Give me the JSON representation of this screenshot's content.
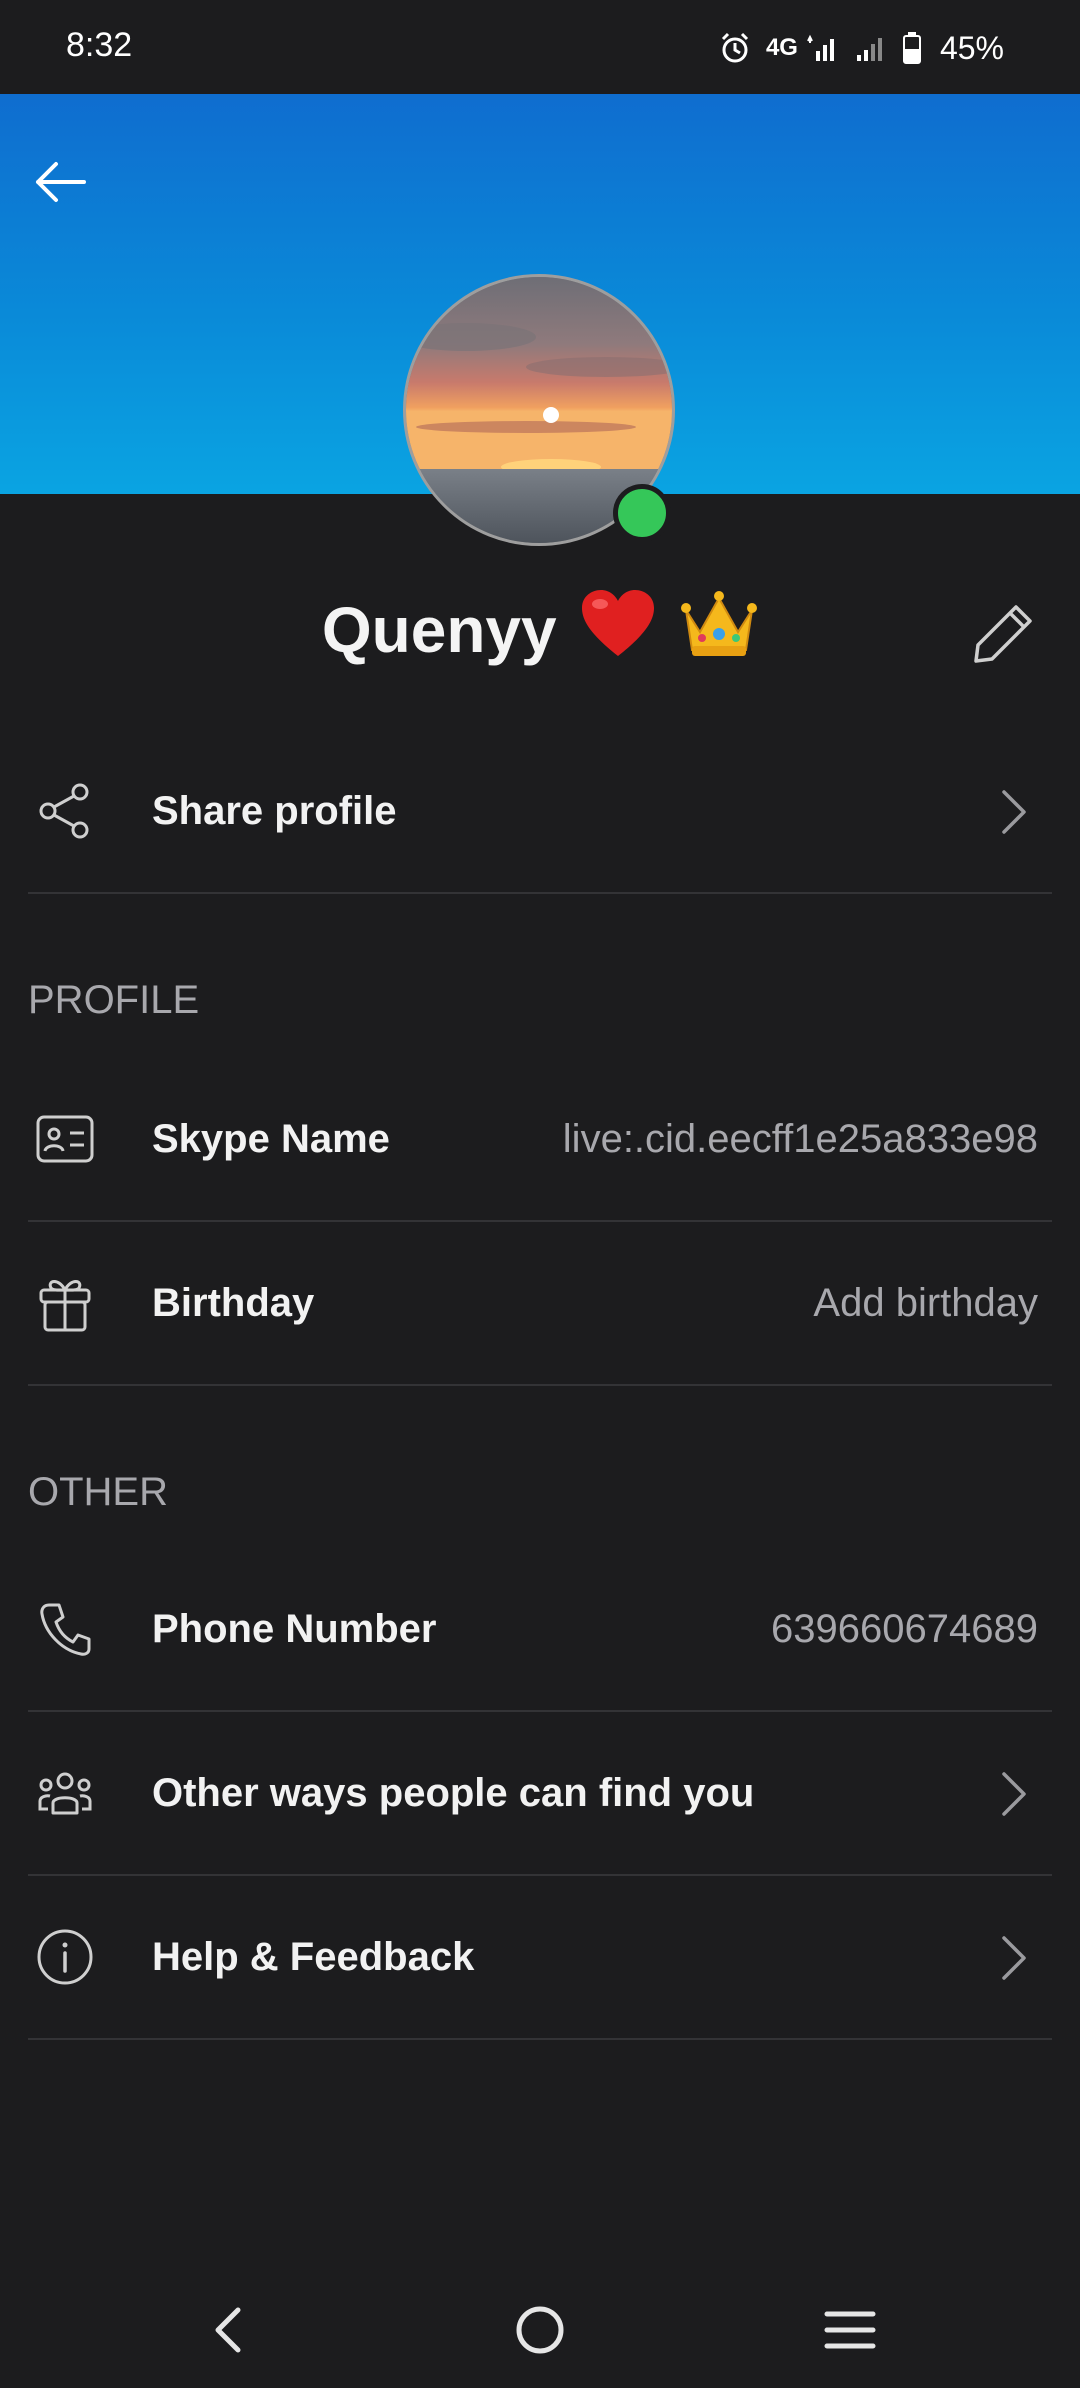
{
  "status_bar": {
    "time": "8:32",
    "network": "4G",
    "battery": "45%",
    "icons": [
      "alarm-icon",
      "signal-4g-icon",
      "signal-icon",
      "battery-icon"
    ]
  },
  "header": {
    "back_icon": "arrow-left-icon",
    "banner_color": "#0a8ad8"
  },
  "profile": {
    "display_name": "Quenyy",
    "name_emojis": [
      "heart-emoji",
      "crown-emoji"
    ],
    "presence": "online",
    "presence_color": "#35c759",
    "edit_icon": "pencil-icon"
  },
  "share_row": {
    "label": "Share profile",
    "icon": "share-icon"
  },
  "sections": {
    "profile_header": "PROFILE",
    "other_header": "OTHER"
  },
  "profile_rows": {
    "skype_name": {
      "label": "Skype Name",
      "value": "live:.cid.eecff1e25a833e98",
      "icon": "id-card-icon"
    },
    "birthday": {
      "label": "Birthday",
      "value": "Add birthday",
      "icon": "gift-icon"
    }
  },
  "other_rows": {
    "phone": {
      "label": "Phone Number",
      "value": "639660674689",
      "icon": "phone-icon"
    },
    "find_you": {
      "label": "Other ways people can find you",
      "icon": "people-icon"
    },
    "help": {
      "label": "Help & Feedback",
      "icon": "info-icon"
    }
  },
  "nav_bar": {
    "back": "nav-back-icon",
    "home": "nav-home-icon",
    "recents": "nav-recents-icon"
  }
}
